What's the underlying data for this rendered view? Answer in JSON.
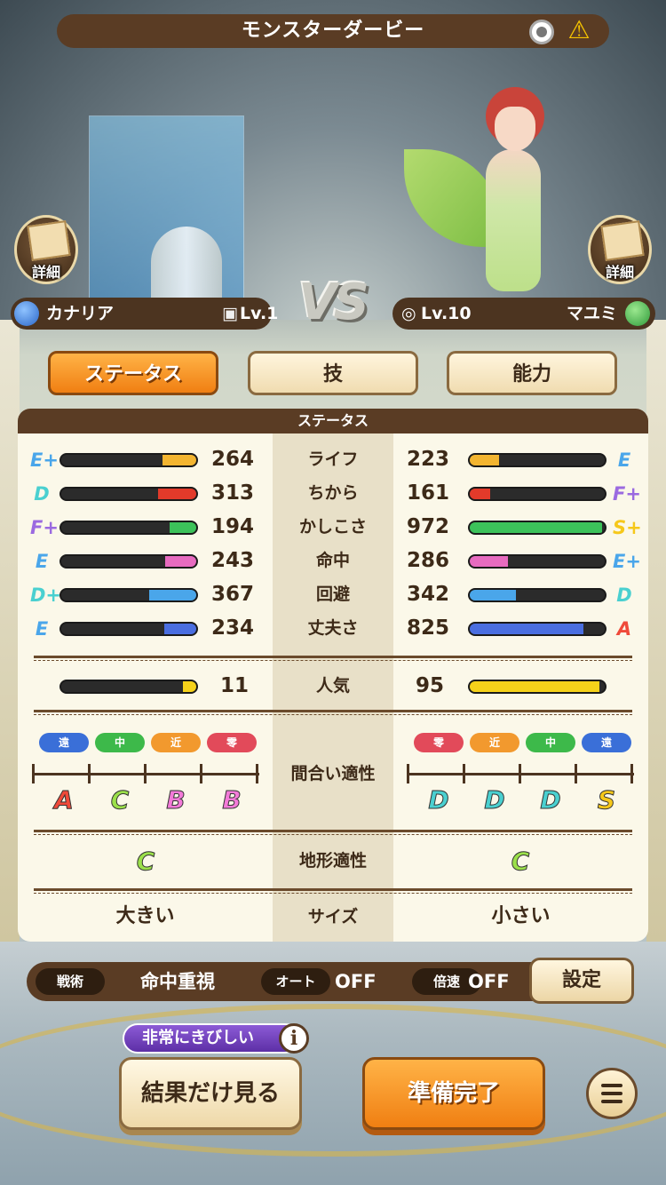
{
  "header": {
    "title": "モンスターダービー",
    "record_icon": "record-icon",
    "warning_icon": "warning-icon"
  },
  "detail_label": "詳細",
  "vs_text": "VS",
  "left": {
    "name": "カナリア",
    "level": "Lv.1",
    "orb_color": "#2a66c8"
  },
  "right": {
    "name": "マユミ",
    "level": "Lv.10",
    "orb_color": "#2f9a3a"
  },
  "tabs": [
    {
      "label": "ステータス",
      "active": true
    },
    {
      "label": "技",
      "active": false
    },
    {
      "label": "能力",
      "active": false
    }
  ],
  "panel_title": "ステータス",
  "stats": [
    {
      "label": "ライフ",
      "left_grade": "E+",
      "left_value": "264",
      "left_fill": 0.25,
      "right_value": "223",
      "right_fill": 0.22,
      "right_grade": "E",
      "color": "#f3b530"
    },
    {
      "label": "ちから",
      "left_grade": "D",
      "left_value": "313",
      "left_fill": 0.28,
      "right_value": "161",
      "right_fill": 0.15,
      "right_grade": "F+",
      "color": "#e23a2a"
    },
    {
      "label": "かしこさ",
      "left_grade": "F+",
      "left_value": "194",
      "left_fill": 0.2,
      "right_value": "972",
      "right_fill": 0.98,
      "right_grade": "S+",
      "color": "#3cc25a"
    },
    {
      "label": "命中",
      "left_grade": "E",
      "left_value": "243",
      "left_fill": 0.23,
      "right_value": "286",
      "right_fill": 0.28,
      "right_grade": "E+",
      "color": "#e76bc0"
    },
    {
      "label": "回避",
      "left_grade": "D+",
      "left_value": "367",
      "left_fill": 0.35,
      "right_value": "342",
      "right_fill": 0.34,
      "right_grade": "D",
      "color": "#4aa6ea"
    },
    {
      "label": "丈夫さ",
      "left_grade": "E",
      "left_value": "234",
      "left_fill": 0.24,
      "right_value": "825",
      "right_fill": 0.84,
      "right_grade": "A",
      "color": "#4a6ee0"
    }
  ],
  "popularity": {
    "label": "人気",
    "left_value": "11",
    "left_fill": 0.1,
    "right_value": "95",
    "right_fill": 0.96,
    "color": "#f6d21a"
  },
  "range_aptitude": {
    "label": "間合い適性",
    "left_ranges": [
      {
        "label": "遠",
        "color": "#3a6fd8"
      },
      {
        "label": "中",
        "color": "#3db94a"
      },
      {
        "label": "近",
        "color": "#f2992e"
      },
      {
        "label": "零",
        "color": "#e24a5a"
      }
    ],
    "left_grades": [
      {
        "grade": "A",
        "color": "#ef4a3a"
      },
      {
        "grade": "C",
        "color": "#9be04a"
      },
      {
        "grade": "B",
        "color": "#f37ad8"
      },
      {
        "grade": "B",
        "color": "#f37ad8"
      }
    ],
    "right_ranges": [
      {
        "label": "零",
        "color": "#e24a5a"
      },
      {
        "label": "近",
        "color": "#f2992e"
      },
      {
        "label": "中",
        "color": "#3db94a"
      },
      {
        "label": "遠",
        "color": "#3a6fd8"
      }
    ],
    "right_grades": [
      {
        "grade": "D",
        "color": "#4ad0d0"
      },
      {
        "grade": "D",
        "color": "#4ad0d0"
      },
      {
        "grade": "D",
        "color": "#4ad0d0"
      },
      {
        "grade": "S",
        "color": "#f6c81a"
      }
    ]
  },
  "terrain": {
    "label": "地形適性",
    "left_grade": "C",
    "right_grade": "C",
    "color": "#9be04a"
  },
  "size": {
    "label": "サイズ",
    "left": "大きい",
    "right": "小さい"
  },
  "tactics": {
    "tactic_label": "戦術",
    "tactic_value": "命中重視",
    "auto_label": "オート",
    "auto_value": "OFF",
    "speed_label": "倍速",
    "speed_value": "OFF",
    "settings_label": "設定"
  },
  "difficulty": "非常にきびしい",
  "info_glyph": "i",
  "buttons": {
    "skip": "結果だけ見る",
    "ready": "準備完了"
  },
  "grade_colors": {
    "S": "#f6c81a",
    "A": "#ef4a3a",
    "B": "#f37ad8",
    "C": "#9be04a",
    "D": "#4ad0d0",
    "E": "#4aa6ea",
    "F": "#9b6ae0"
  }
}
